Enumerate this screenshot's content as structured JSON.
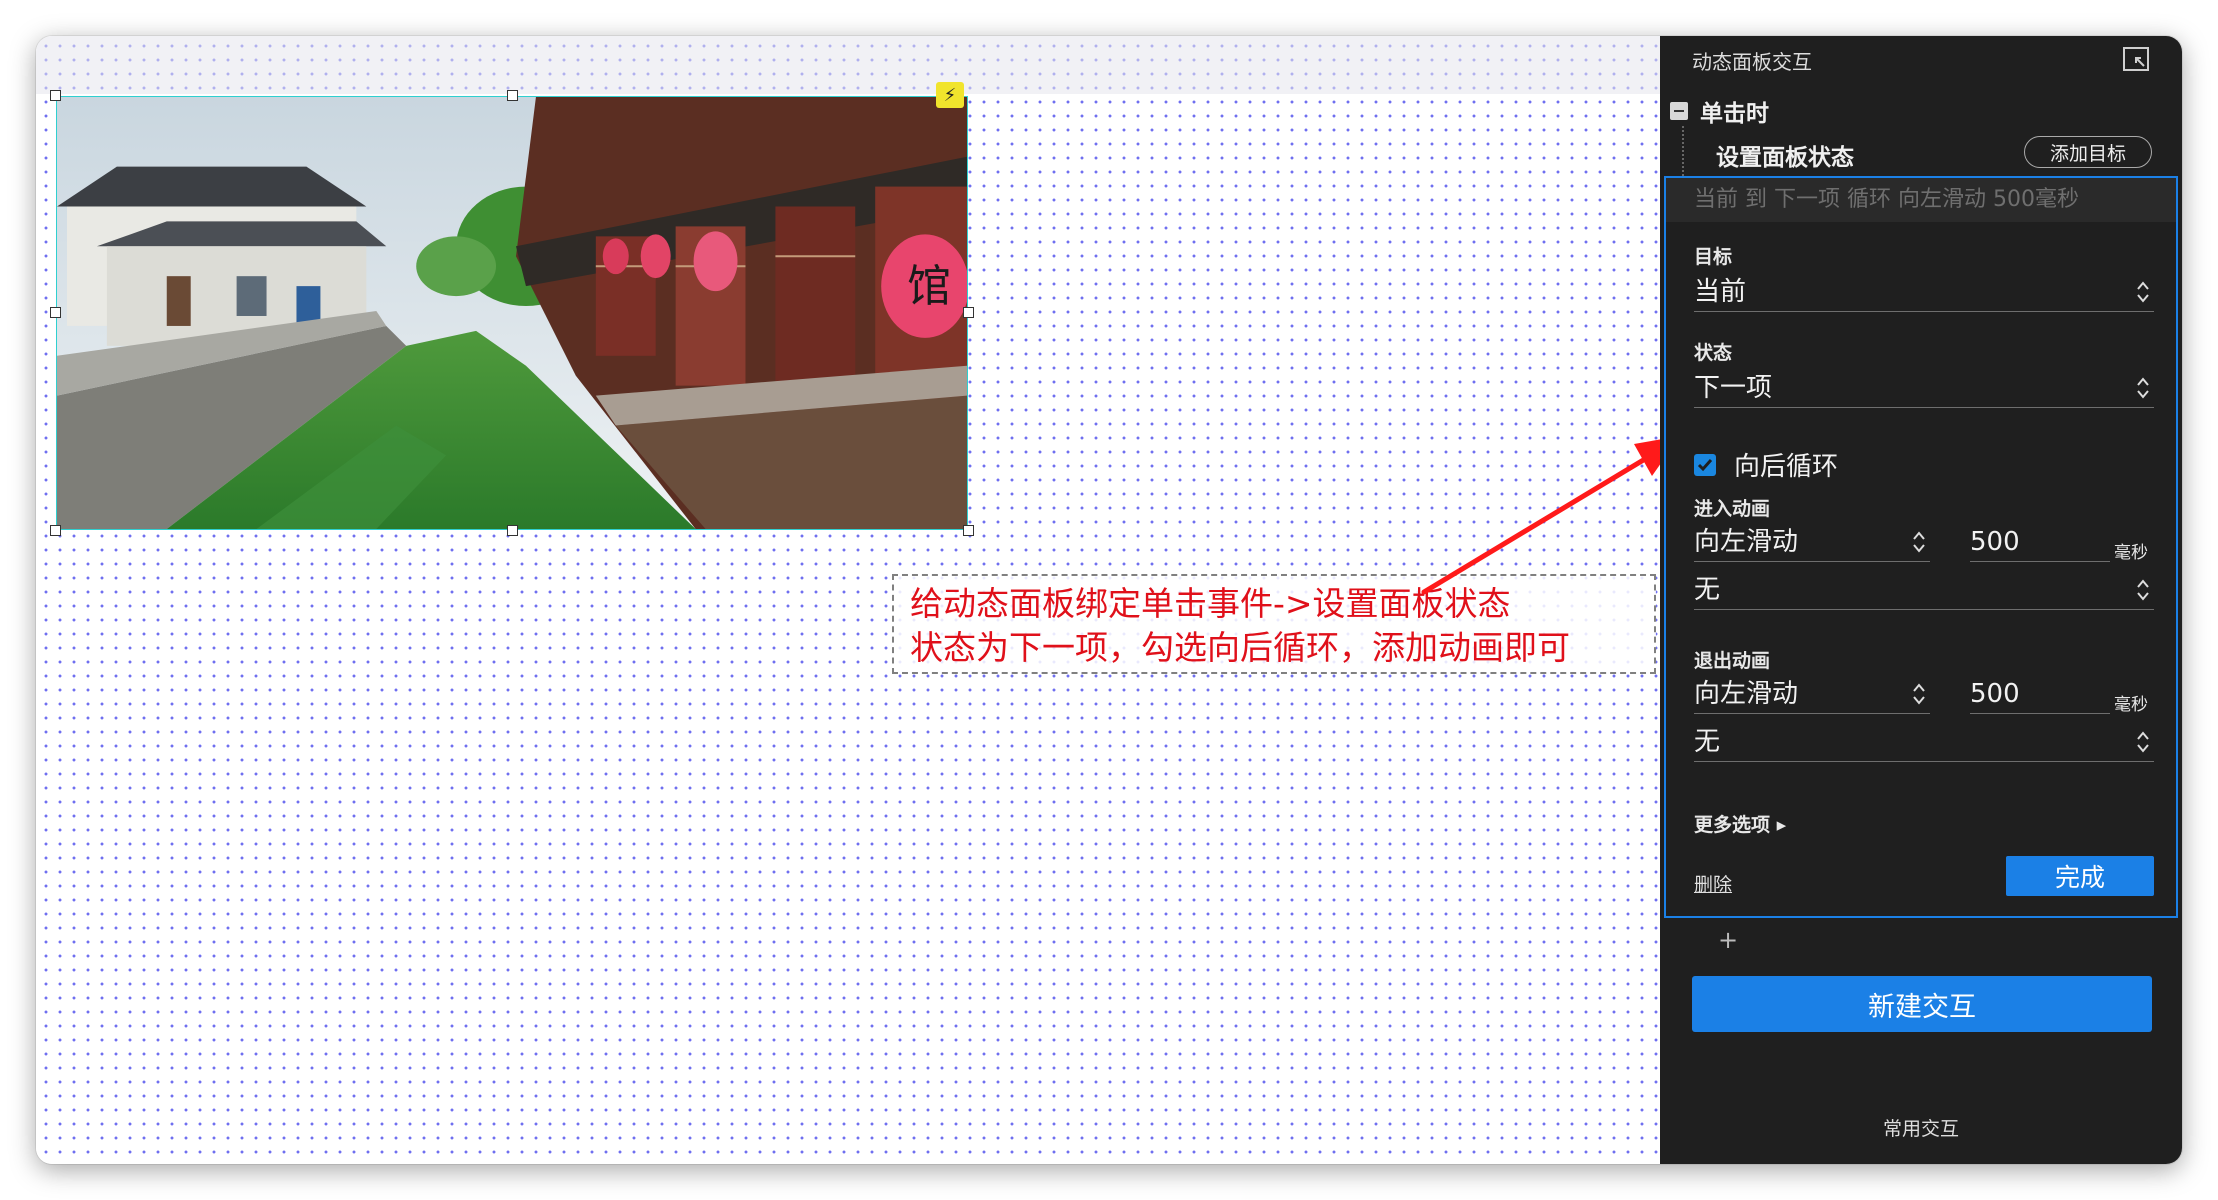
{
  "panel": {
    "title": "动态面板交互",
    "event_label": "单击时",
    "action_label": "设置面板状态",
    "add_target_label": "添加目标",
    "summary": "当前 到 下一项 循环 向左滑动 500毫秒",
    "target": {
      "label": "目标",
      "value": "当前"
    },
    "state": {
      "label": "状态",
      "value": "下一项"
    },
    "loop": {
      "label": "向后循环",
      "checked": true
    },
    "enter_animation": {
      "label": "进入动画",
      "type": "向左滑动",
      "duration": "500",
      "unit": "毫秒",
      "easing": "无"
    },
    "exit_animation": {
      "label": "退出动画",
      "type": "向左滑动",
      "duration": "500",
      "unit": "毫秒",
      "easing": "无"
    },
    "more_options_label": "更多选项 ▸",
    "delete_label": "删除",
    "done_label": "完成",
    "add_label": "+",
    "new_interaction_label": "新建交互",
    "common_interactions_label": "常用交互"
  },
  "annotation": {
    "line1": "给动态面板绑定单击事件->设置面板状态",
    "line2": "状态为下一项，勾选向后循环，添加动画即可"
  },
  "widget": {
    "badge_icon": "lightning-icon",
    "lantern_text": "馆"
  },
  "colors": {
    "accent_blue": "#1b80e6",
    "panel_bg": "#1f1f1f",
    "annotation_red": "#e0101a",
    "arrow_red": "#ff1a1a",
    "selection_cyan": "#2fd0d0",
    "badge_yellow": "#f1e42c"
  }
}
